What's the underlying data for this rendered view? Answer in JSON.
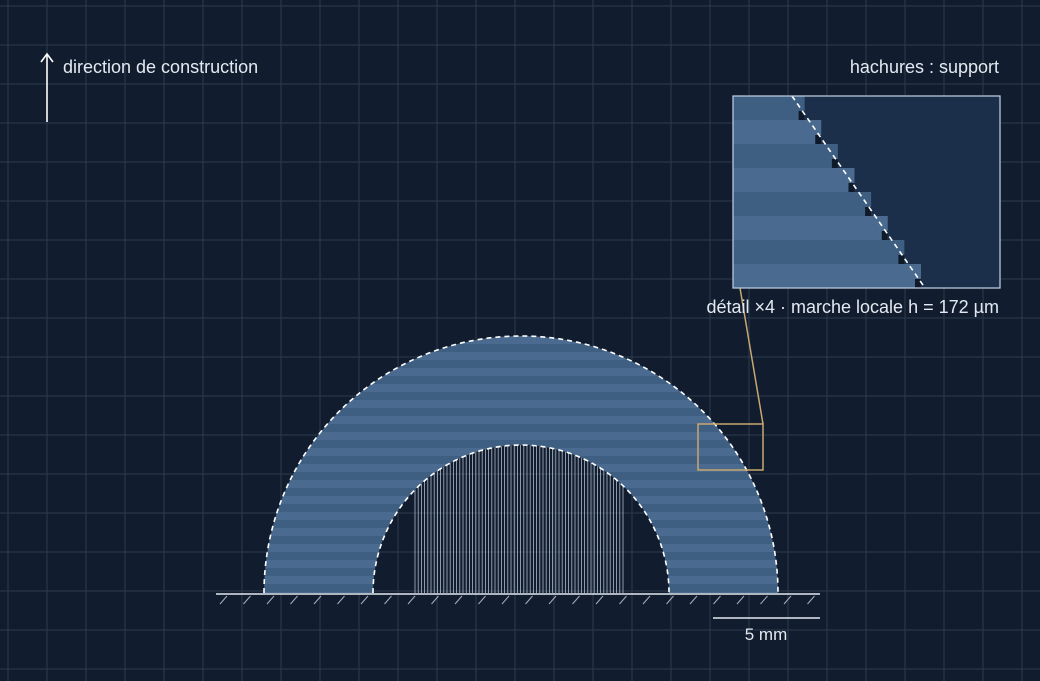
{
  "labels": {
    "build_direction": "direction de construction",
    "hatch_legend": "hachures : support",
    "detail_caption": "détail ×4 · marche locale h = 172 µm",
    "scale_bar": "5 mm"
  },
  "colors": {
    "background": "#111d2e",
    "grid": "#2a3a4f",
    "layer_light": "#4a6b8f",
    "layer_dark": "#3f5f82",
    "outline": "#ffffff",
    "support_hatch": "#c9d6e6",
    "detail_frame": "#c8a86e",
    "inset_background": "#1b2f4a",
    "text": "#e3e9f0"
  },
  "icons": {
    "build_arrow": "arrow-up-icon"
  }
}
